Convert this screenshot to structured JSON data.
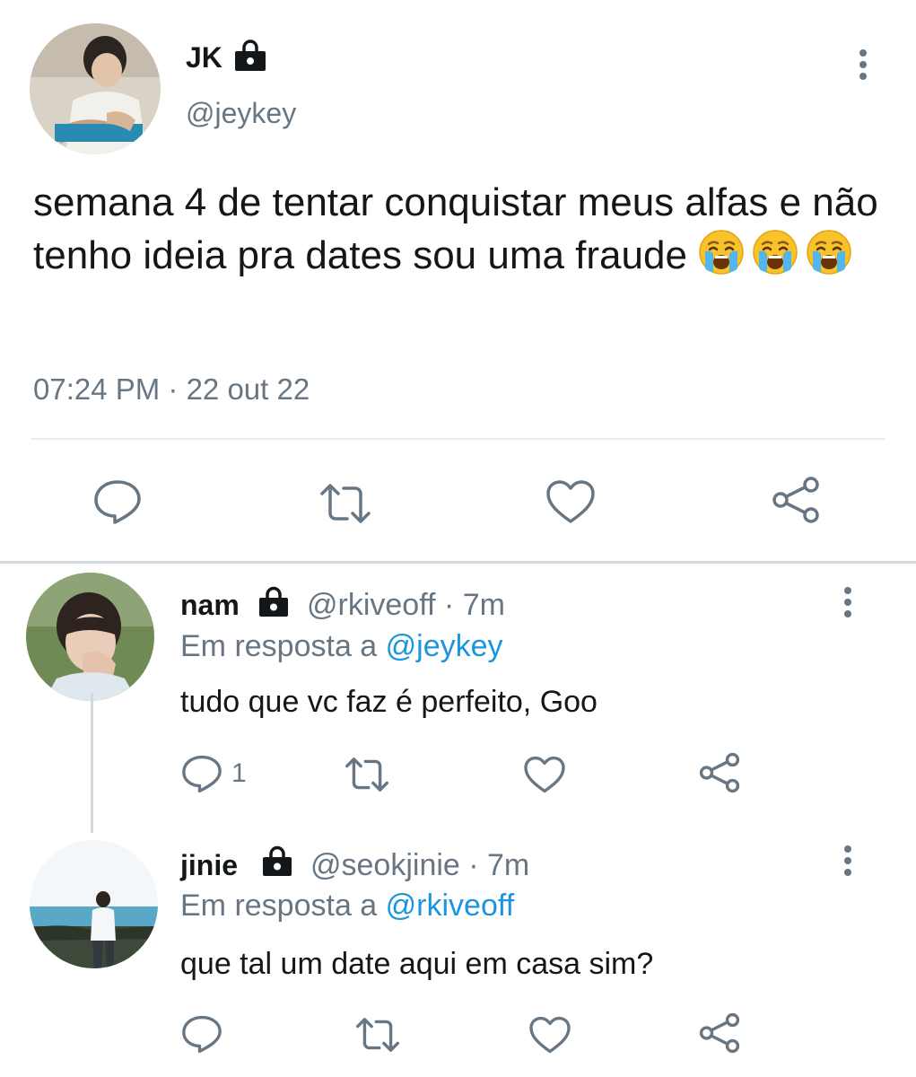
{
  "main_tweet": {
    "name": "JK",
    "handle": "@jeykey",
    "text": "semana 4 de tentar conquistar meus alfas e não tenho ideia pra dates sou uma fraude",
    "emoji_count": 3,
    "timestamp": "07:24 PM · 22 out 22",
    "actions": [
      "reply-icon",
      "retweet-icon",
      "like-icon",
      "share-icon"
    ]
  },
  "replies": [
    {
      "name": "nam",
      "handle_time": "@rkiveoff · 7m",
      "reply_prefix": "Em resposta a ",
      "reply_to": "@jeykey",
      "text": "tudo que vc faz é perfeito, Goo",
      "reply_count": "1"
    },
    {
      "name": "jinie",
      "handle_time": "@seokjinie · 7m",
      "reply_prefix": "Em resposta a ",
      "reply_to": "@rkiveoff",
      "text": "que tal um date aqui em casa sim?",
      "reply_count": ""
    }
  ],
  "colors": {
    "text": "#14171a",
    "secondary": "#687684",
    "link": "#1b95e0",
    "divider": "#e6ecf0"
  }
}
